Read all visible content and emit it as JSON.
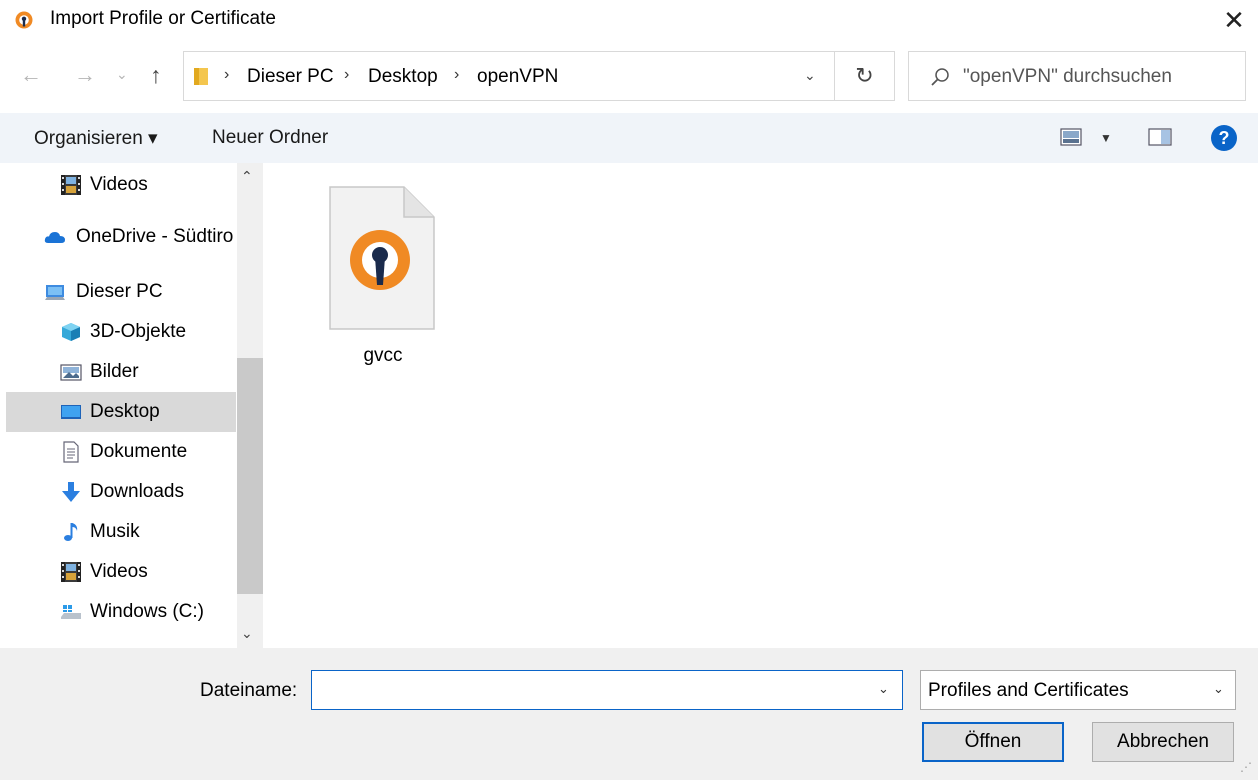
{
  "window": {
    "title": "Import Profile or Certificate",
    "close_glyph": "✕"
  },
  "nav": {
    "back_glyph": "←",
    "forward_glyph": "→",
    "recent_glyph": "⌄",
    "up_glyph": "↑",
    "refresh_glyph": "↻",
    "sep_glyph": "›",
    "dropdown_glyph": "⌄"
  },
  "breadcrumb": [
    "Dieser PC",
    "Desktop",
    "openVPN"
  ],
  "search": {
    "placeholder": "\"openVPN\" durchsuchen"
  },
  "toolbar": {
    "organize_label": "Organisieren ▾",
    "new_folder_label": "Neuer Ordner",
    "view_dropdown_glyph": "▼"
  },
  "sidebar": {
    "scroll_up_glyph": "⌃",
    "scroll_down_glyph": "⌄",
    "items": [
      {
        "label": "Videos",
        "icon": "video-icon"
      },
      {
        "label": "OneDrive - Südtiro",
        "icon": "cloud-icon"
      },
      {
        "label": "Dieser PC",
        "icon": "computer-icon"
      },
      {
        "label": "3D-Objekte",
        "icon": "cube-icon"
      },
      {
        "label": "Bilder",
        "icon": "pictures-icon"
      },
      {
        "label": "Desktop",
        "icon": "desktop-icon",
        "selected": true
      },
      {
        "label": "Dokumente",
        "icon": "document-icon"
      },
      {
        "label": "Downloads",
        "icon": "download-icon"
      },
      {
        "label": "Musik",
        "icon": "music-icon"
      },
      {
        "label": "Videos",
        "icon": "video-icon"
      },
      {
        "label": "Windows  (C:)",
        "icon": "drive-icon"
      }
    ]
  },
  "files": [
    {
      "name": "gvcc",
      "icon": "openvpn-file-icon"
    }
  ],
  "bottom": {
    "filename_label": "Dateiname:",
    "filename_value": "",
    "filetype_selected": "Profiles and Certificates",
    "open_label": "Öffnen",
    "cancel_label": "Abbrechen",
    "dropdown_glyph": "⌄"
  },
  "colors": {
    "openvpn_orange": "#f08a24",
    "openvpn_navy": "#1a2b4c",
    "accent_blue": "#0a64c8",
    "selected_bg": "#d9d9d9",
    "toolbar_bg": "#f0f4f9"
  }
}
